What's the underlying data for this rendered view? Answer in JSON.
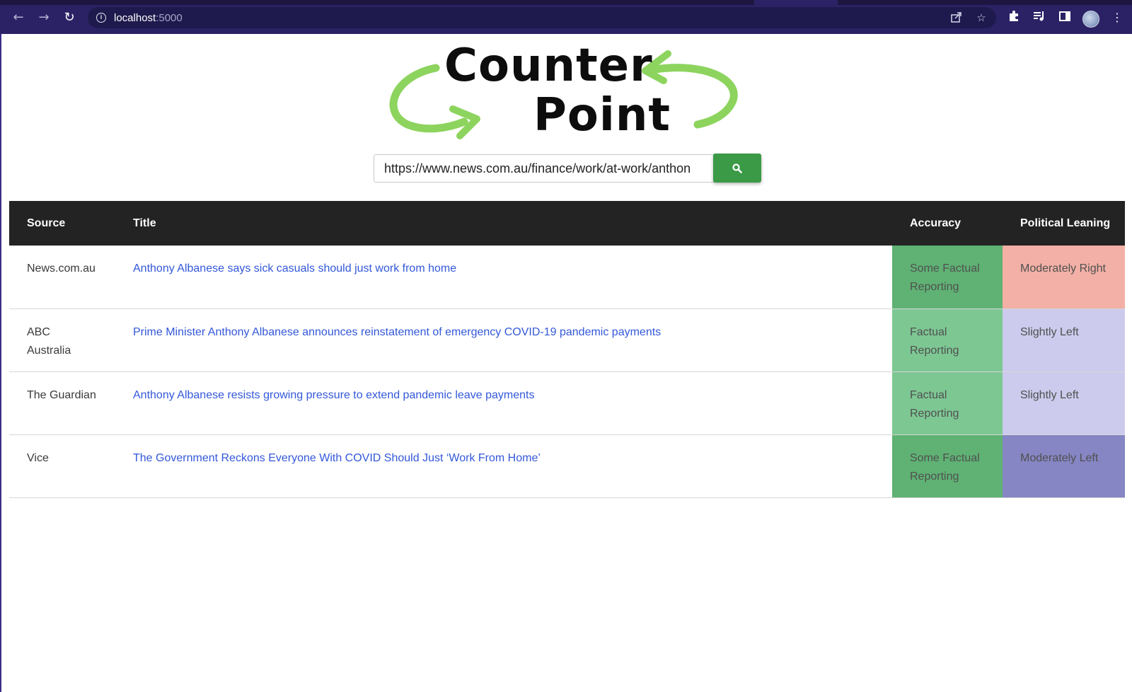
{
  "browser": {
    "url_host": "localhost",
    "url_port": ":5000",
    "icons": {
      "back": "arrow-left-icon",
      "forward": "arrow-right-icon",
      "reload": "reload-icon",
      "info": "info-icon",
      "share": "share-icon",
      "bookmark": "star-icon",
      "extensions": "puzzle-icon",
      "media": "media-queue-icon",
      "side_panel": "side-panel-icon",
      "profile": "avatar",
      "menu": "kebab-menu-icon"
    }
  },
  "logo": {
    "line1": "Counter",
    "line2": "Point",
    "arrow_color": "#8dd45e"
  },
  "search": {
    "value": "https://www.news.com.au/finance/work/at-work/anthon",
    "button_icon": "search-icon",
    "button_color": "#3a9a46"
  },
  "table": {
    "headers": {
      "source": "Source",
      "title": "Title",
      "accuracy": "Accuracy",
      "leaning": "Political Leaning"
    },
    "rows": [
      {
        "source": "News.com.au",
        "title": "Anthony Albanese says sick casuals should just work from home",
        "accuracy": "Some Factual Reporting",
        "accuracy_color": "#5fb274",
        "leaning": "Moderately Right",
        "leaning_color": "#f2b0a6"
      },
      {
        "source": "ABC Australia",
        "title": "Prime Minister Anthony Albanese announces reinstatement of emergency COVID-19 pandemic payments",
        "accuracy": "Factual Reporting",
        "accuracy_color": "#7dc793",
        "leaning": "Slightly Left",
        "leaning_color": "#cccbed"
      },
      {
        "source": "The Guardian",
        "title": "Anthony Albanese resists growing pressure to extend pandemic leave payments",
        "accuracy": "Factual Reporting",
        "accuracy_color": "#7dc793",
        "leaning": "Slightly Left",
        "leaning_color": "#cccbed"
      },
      {
        "source": "Vice",
        "title": "The Government Reckons Everyone With COVID Should Just ‘Work From Home’",
        "accuracy": "Some Factual Reporting",
        "accuracy_color": "#5fb274",
        "leaning": "Moderately Left",
        "leaning_color": "#8686c4"
      }
    ]
  }
}
